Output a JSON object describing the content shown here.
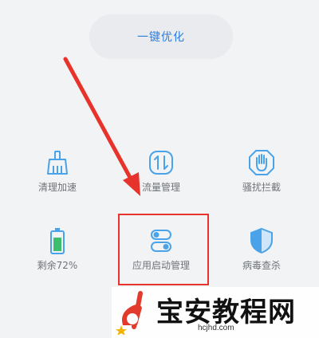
{
  "optimize_button": {
    "label": "一键优化"
  },
  "tiles": [
    {
      "id": "clean",
      "label": "清理加速"
    },
    {
      "id": "traffic",
      "label": "流量管理"
    },
    {
      "id": "harass",
      "label": "骚扰拦截"
    },
    {
      "id": "battery",
      "label": "剩余72%"
    },
    {
      "id": "autostart",
      "label": "应用启动管理"
    },
    {
      "id": "virus",
      "label": "病毒查杀"
    }
  ],
  "watermark": {
    "site_name": "宝安教程网",
    "url": "hcjhd.com"
  },
  "colors": {
    "accent": "#2b7fe0",
    "icon_blue": "#4aa3e8",
    "highlight": "#e8332c",
    "background": "#f2f3f5"
  }
}
